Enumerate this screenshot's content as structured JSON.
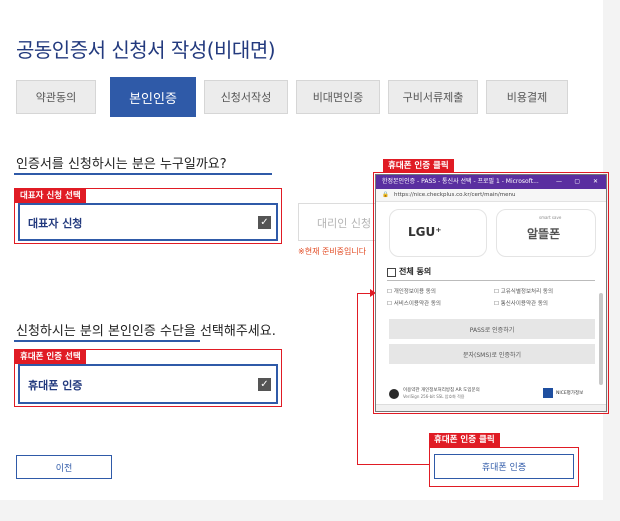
{
  "page_title": "공동인증서 신청서 작성(비대면)",
  "steps": [
    "약관동의",
    "본인인증",
    "신청서작성",
    "비대면인증",
    "구비서류제출",
    "비용결제"
  ],
  "q1": {
    "question": "인증서를 신청하시는 분은 누구일까요?",
    "tag": "대표자 신청 선택",
    "option_selected": "대표자 신청",
    "option_disabled": "대리인 신청",
    "note": "※현재 준비중입니다"
  },
  "q2": {
    "question": "신청하시는 분의 본인인증 수단을 선택해주세요.",
    "tag": "휴대폰 인증 선택",
    "option_selected": "휴대폰 인증"
  },
  "popup": {
    "tag": "휴대폰 인증 클릭",
    "window_title": "한정본인인증 - PASS - 통신사 선택 - 프로필 1 - Microsoft...",
    "url": "https://nice.checkplus.co.kr/cert/main/menu",
    "carrier_left": "LGU⁺",
    "carrier_right": "알뜰폰",
    "carrier_right_sub": "smart save",
    "agree_all": "전체 동의",
    "agree_items": [
      "개인정보이용 동의",
      "고유식별정보처리 동의",
      "서비스이용약관 동의",
      "통신사이용약관 동의"
    ],
    "btn_pass": "PASS로 인증하기",
    "btn_sms": "문자(SMS)로 인증하기",
    "footer_text": "이용약관  개인정보처리방침  AR 도입문의",
    "footer_sub": "VeriSign 256-bit SSL 암호화 적용",
    "footer_logo": "NICE평가정보"
  },
  "bottom": {
    "prev_button": "이전",
    "tag": "휴대폰 인증 클릭",
    "phone_button": "휴대폰 인증"
  },
  "colors": {
    "accent": "#2f5aa8",
    "title": "#233a7e",
    "highlight": "#e01b24",
    "popup_bar": "#5a2fa0"
  }
}
